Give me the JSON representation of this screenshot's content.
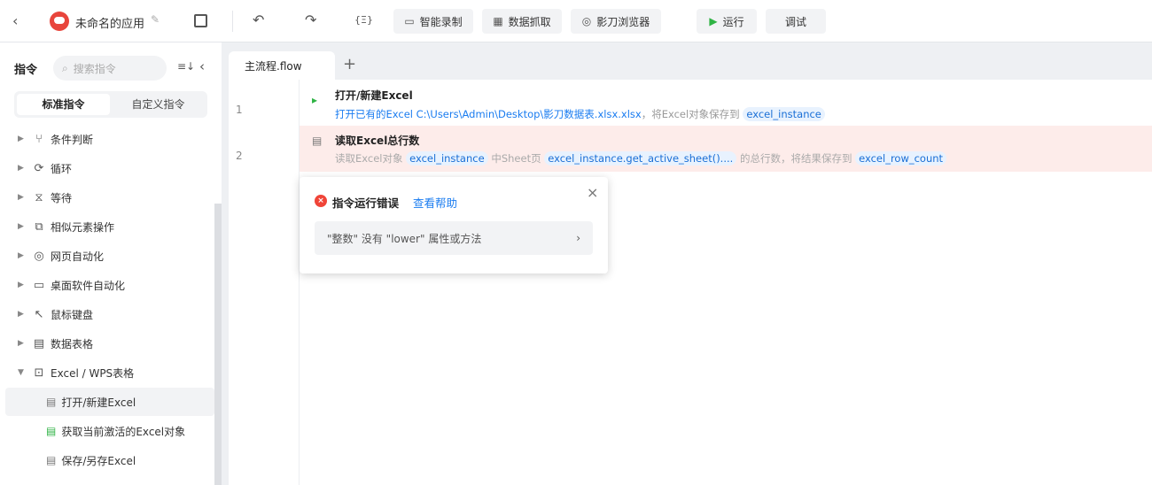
{
  "topbar": {
    "app_name": "未命名的应用",
    "record": "智能录制",
    "scrape": "数据抓取",
    "browser": "影刀浏览器",
    "run": "运行",
    "debug": "调试",
    "var_icon": "{Ξ}"
  },
  "sidebar": {
    "title": "指令",
    "search_placeholder": "搜索指令",
    "tab_standard": "标准指令",
    "tab_custom": "自定义指令",
    "items": [
      {
        "label": "条件判断",
        "icon": "⑂"
      },
      {
        "label": "循环",
        "icon": "⟳"
      },
      {
        "label": "等待",
        "icon": "⧖"
      },
      {
        "label": "相似元素操作",
        "icon": "⧉"
      },
      {
        "label": "网页自动化",
        "icon": "◎"
      },
      {
        "label": "桌面软件自动化",
        "icon": "▭"
      },
      {
        "label": "鼠标键盘",
        "icon": "↖"
      },
      {
        "label": "数据表格",
        "icon": "▤"
      },
      {
        "label": "Excel / WPS表格",
        "icon": "⊡"
      }
    ],
    "subitems": [
      {
        "label": "打开/新建Excel"
      },
      {
        "label": "获取当前激活的Excel对象"
      },
      {
        "label": "保存/另存Excel"
      }
    ]
  },
  "editor": {
    "tab": "主流程.flow",
    "add": "+",
    "steps": [
      {
        "num": "1",
        "title": "打开/新建Excel",
        "desc": "打开已有的Excel C:\\Users\\Admin\\Desktop\\影刀数据表.xlsx.xlsx",
        "desc2": "，将Excel对象保存到",
        "var": "excel_instance"
      },
      {
        "num": "2",
        "title": "读取Excel总行数",
        "p1": "读取Excel对象",
        "v1": "excel_instance",
        "p2": "中Sheet页",
        "v2": "excel_instance.get_active_sheet()....",
        "p3": "的总行数，将结果保存到",
        "v3": "excel_row_count"
      }
    ]
  },
  "error": {
    "title": "指令运行错误",
    "help": "查看帮助",
    "message": "\"整数\" 没有 \"lower\" 属性或方法"
  },
  "colors": {
    "accent": "#1a7cf0",
    "error_bg": "#fdecea",
    "error": "#f04438",
    "run": "#2fb344"
  }
}
